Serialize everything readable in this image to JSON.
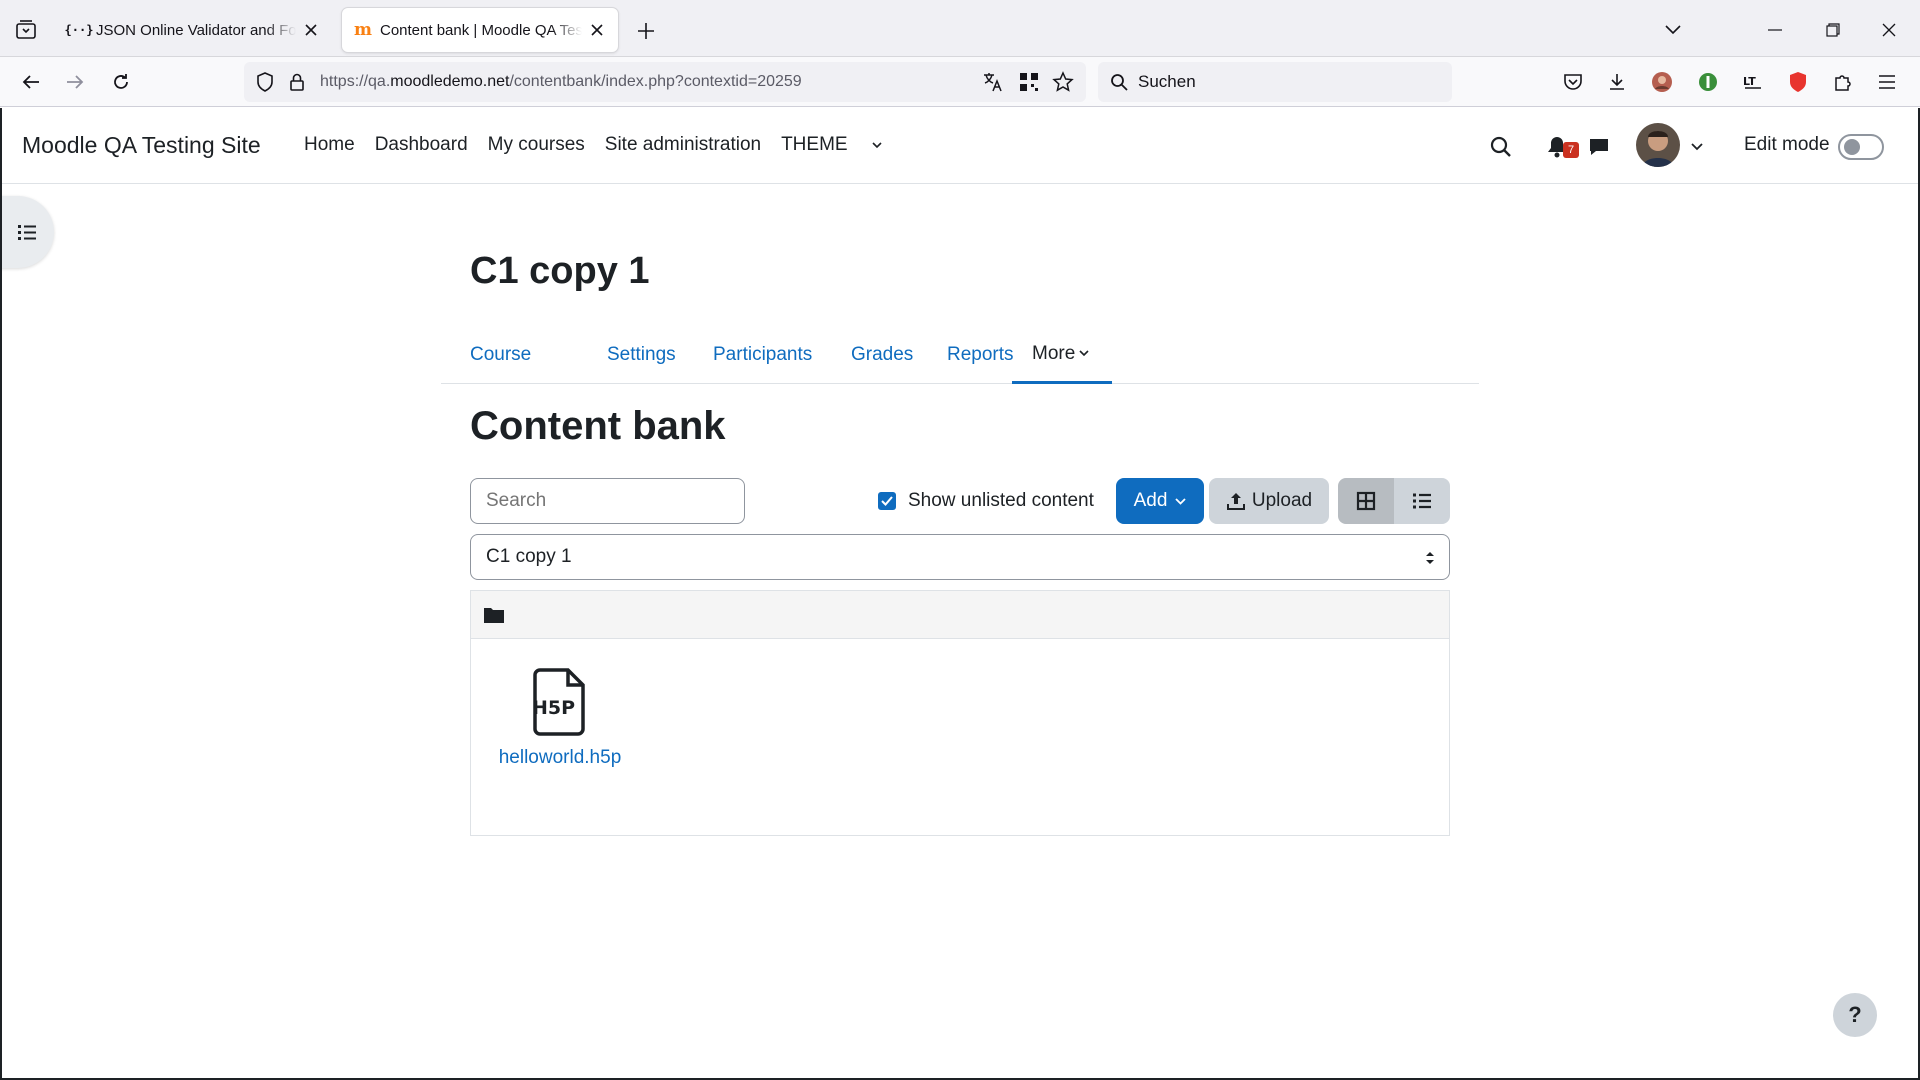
{
  "browser": {
    "tabs": [
      {
        "title": "JSON Online Validator and Formatter",
        "favicon": "{··}"
      },
      {
        "title": "Content bank | Moodle QA Testing Site",
        "favicon": "m"
      }
    ],
    "url_prefix": "https://qa.",
    "url_domain": "moodledemo.net",
    "url_path": "/contentbank/index.php?contextid=20259",
    "search_placeholder": "Suchen"
  },
  "header": {
    "site_name": "Moodle QA Testing Site",
    "nav": [
      "Home",
      "Dashboard",
      "My courses",
      "Site administration",
      "THEME"
    ],
    "notification_count": "7",
    "edit_mode_label": "Edit mode"
  },
  "course": {
    "title": "C1 copy 1",
    "tabs": [
      "Course",
      "Settings",
      "Participants",
      "Grades",
      "Reports",
      "More"
    ]
  },
  "contentbank": {
    "heading": "Content bank",
    "search_placeholder": "Search",
    "show_unlisted_label": "Show unlisted content",
    "add_label": "Add",
    "upload_label": "Upload",
    "context_selected": "C1 copy 1",
    "files": [
      {
        "name": "helloworld.h5p",
        "type_label": "H5P"
      }
    ]
  },
  "help_label": "?",
  "colors": {
    "primary": "#0f6cbf",
    "badge": "#ca3120"
  }
}
